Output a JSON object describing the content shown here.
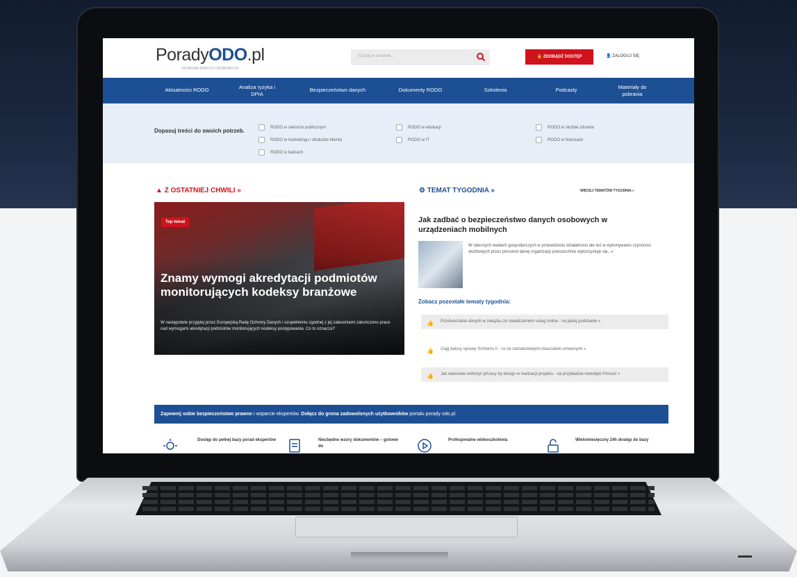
{
  "site": {
    "logo_main": "Porady",
    "logo_brand": "ODO",
    "logo_tld": ".pl",
    "tagline": "OCHRONA DANYCH OSOBOWYCH"
  },
  "header": {
    "search_placeholder": "Szukaj w serwisie...",
    "access_button": "ZDOBĄDŹ DOSTĘP",
    "login_label": "ZALOGUJ SIĘ"
  },
  "nav": {
    "items": [
      "Aktualności RODO",
      "Analiza ryzyka i DPIA",
      "Bezpieczeństwo danych",
      "Dokumenty RODO",
      "Szkolenia",
      "Podcasty",
      "Materiały do pobrania"
    ]
  },
  "filter": {
    "title": "Dopasuj treści do swoich potrzeb.",
    "options": [
      "RODO w sektorze publicznym",
      "RODO w marketingu i obsłudze klienta",
      "RODO w kadrach",
      "RODO w edukacji",
      "RODO w IT",
      "RODO w służbie zdrowia",
      "RODO w finansach"
    ]
  },
  "latest": {
    "heading": "Z OSTATNIEJ CHWILI »",
    "tag": "Top temat",
    "title": "Znamy wymogi akredytacji podmiotów monitorujących kodeksy branżowe",
    "text": "W następstwie przyjętej przez Europejską Radę Ochrony Danych i uzupełnieniu zgodnej z jej zaleceniami zakończono prace nad wymogami akredytacji podmiotów monitorujących kodeksy postępowania. Co to oznacza?"
  },
  "topic": {
    "heading": "TEMAT TYGODNIA »",
    "more_link": "WIĘCEJ TEMATÓW TYGODNIA »",
    "title": "Jak zadbać o bezpieczeństwo danych osobowych w urządzeniach mobilnych",
    "text": "W obecnych realiach gospodarczych w prowadzeniu działalności ale też w wykonywaniu czynności służbowych przez personel danej organizacji powszechnie wykorzystuje się...»",
    "see_other": "Zobacz pozostałe tematy tygodnia:",
    "others": [
      "Przetwarzanie danych w związku ze świadczeniem usług online - na jakiej podstawie »",
      "Ciąg dalszy sprawy Schrems II - co ze standardowymi klauzulami umownymi »",
      "Jak właściwie wdrożyć privacy by design w realizacji projektu - na przykładzie metodyki Prince2 »"
    ]
  },
  "banner": {
    "strong1": "Zapewnij sobie bezpieczeństwo prawne",
    "normal1": " i wsparcie ekspertów. ",
    "strong2": "Dołącz do grona zadowolonych użytkowników",
    "normal2": " portalu porady odo.pl."
  },
  "features": [
    "Dostęp do pełnej bazy porad ekspertów",
    "Niezbędne wzory dokumentów – gotowe do",
    "Profesjonalne wideoszkolenia",
    "Wielomiesięczny 24h dostęp do bazy"
  ]
}
